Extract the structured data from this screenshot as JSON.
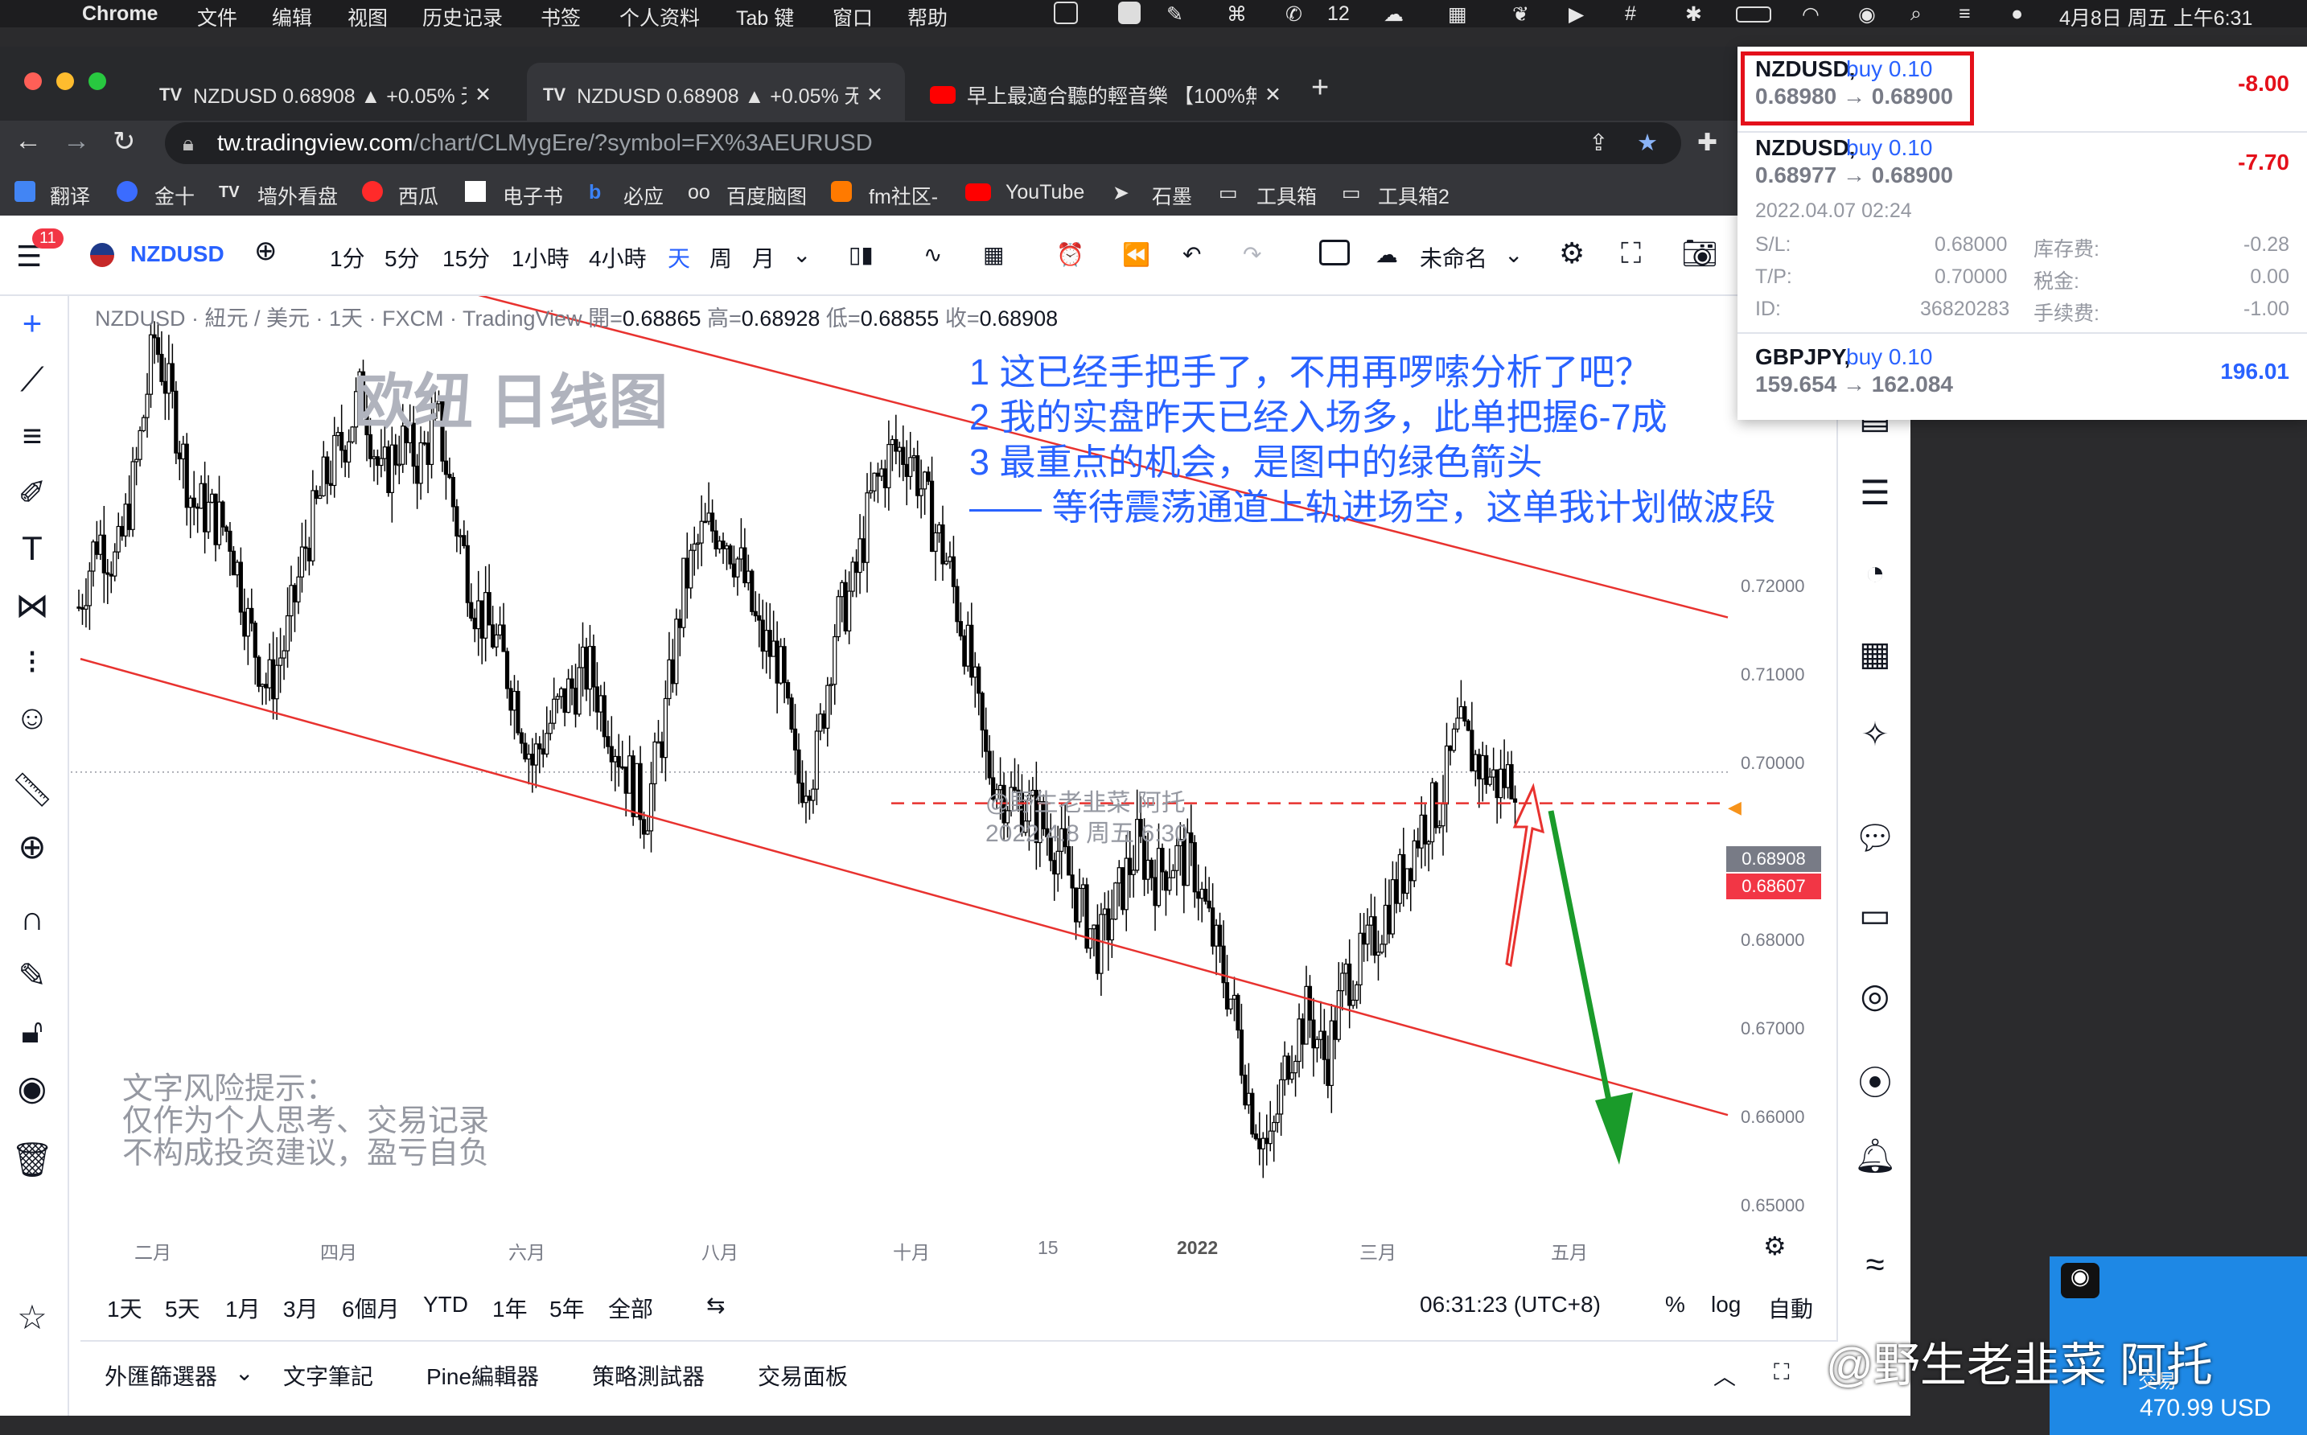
{
  "menubar": {
    "app": "Chrome",
    "items": [
      "文件",
      "编辑",
      "视图",
      "历史记录",
      "书签",
      "个人资料",
      "Tab 键",
      "窗口",
      "帮助"
    ],
    "wechat_count": "12",
    "datetime": "4月8日 周五 上午6:31"
  },
  "tabs": [
    {
      "title": "NZDUSD 0.68908 ▲ +0.05% 无"
    },
    {
      "title": "NZDUSD 0.68908 ▲ +0.05% 无"
    },
    {
      "title": "早上最適合聽的輕音樂 【100%無"
    }
  ],
  "address": {
    "url_host": "tw.tradingview.com",
    "url_path": "/chart/CLMygEre/?symbol=FX%3AEURUSD"
  },
  "bookmarks": [
    "翻译",
    "金十",
    "墙外看盘",
    "西瓜",
    "电子书",
    "必应",
    "百度脑图",
    "fm社区-",
    "YouTube",
    "石墨",
    "工具箱",
    "工具箱2"
  ],
  "toolbar": {
    "badge": "11",
    "symbol": "NZDUSD",
    "intervals": [
      "1分",
      "5分",
      "15分",
      "1小時",
      "4小時",
      "天",
      "周",
      "月"
    ],
    "active_interval": "天",
    "layout_name": "未命名"
  },
  "legend": {
    "title": "NZDUSD · 紐元 / 美元 · 1天 · FXCM · TradingView",
    "open_label": "開",
    "open": "0.68865",
    "high_label": "高",
    "high": "0.68928",
    "low_label": "低",
    "low": "0.68855",
    "close_label": "收",
    "close": "0.68908"
  },
  "watermark_title": "欧纽 日线图",
  "annotations": [
    "1 这已经手把手了，不用再啰嗦分析了吧？",
    "2 我的实盘昨天已经入场多，此单把握6-7成",
    "3 最重点的机会，是图中的绿色箭头",
    "—— 等待震荡通道上轨进场空，这单我计划做波段"
  ],
  "author_mark": {
    "line1": "@野生老韭菜 阿托",
    "line2": "2022.4.8 周五 6:30"
  },
  "risk_note": [
    "文字风险提示：",
    "仅作为个人思考、交易记录",
    "不构成投资建议，盈亏自负"
  ],
  "price_axis": [
    "0.72000",
    "0.71000",
    "0.70000",
    "0.68000",
    "0.67000",
    "0.66000",
    "0.65000"
  ],
  "price_tags": {
    "current": "0.68908",
    "order": "0.68607"
  },
  "time_axis": [
    "二月",
    "四月",
    "六月",
    "八月",
    "十月",
    "15",
    "2022",
    "三月",
    "五月"
  ],
  "bottom_bar": {
    "ranges": [
      "1天",
      "5天",
      "1月",
      "3月",
      "6個月",
      "YTD",
      "1年",
      "5年",
      "全部"
    ],
    "clock": "06:31:23 (UTC+8)",
    "percent": "%",
    "log": "log",
    "auto": "自動"
  },
  "panels": [
    "外匯篩選器",
    "文字筆記",
    "Pine編輯器",
    "策略測試器",
    "交易面板"
  ],
  "positions": [
    {
      "symbol": "NZDUSD,",
      "side": "buy 0.10",
      "prices": "0.68980 → 0.68900",
      "pnl": "-8.00"
    },
    {
      "symbol": "NZDUSD,",
      "side": "buy 0.10",
      "prices": "0.68977 → 0.68900",
      "pnl": "-7.70",
      "time": "2022.04.07 02:24",
      "sl_label": "S/L:",
      "sl": "0.68000",
      "swap_label": "库存费:",
      "swap": "-0.28",
      "tp_label": "T/P:",
      "tp": "0.70000",
      "tax_label": "税金:",
      "tax": "0.00",
      "id_label": "ID:",
      "id": "36820283",
      "fee_label": "手续费:",
      "fee": "-1.00"
    },
    {
      "symbol": "GBPJPY,",
      "side": "buy 0.10",
      "prices": "159.654 → 162.084",
      "pnl": "196.01"
    }
  ],
  "widget": {
    "balance": "470.99 USD",
    "label": "交易"
  },
  "weibo_mark": "@野生老韭菜 阿托",
  "colors": {
    "channel": "#e8322f",
    "arrow_up": "#e8322f",
    "arrow_down": "#1a9b2a",
    "annotation": "#2962ff",
    "price_tag": "#f23645",
    "current_tag": "#787b86"
  },
  "chart_data": {
    "type": "candlestick",
    "symbol": "NZDUSD",
    "interval": "1D",
    "ylim": [
      0.645,
      0.735
    ],
    "close_path": [
      0.705,
      0.712,
      0.709,
      0.718,
      0.731,
      0.724,
      0.715,
      0.714,
      0.712,
      0.703,
      0.697,
      0.702,
      0.711,
      0.717,
      0.721,
      0.726,
      0.717,
      0.721,
      0.719,
      0.723,
      0.713,
      0.705,
      0.702,
      0.697,
      0.69,
      0.694,
      0.697,
      0.699,
      0.694,
      0.689,
      0.685,
      0.694,
      0.707,
      0.712,
      0.713,
      0.709,
      0.702,
      0.7,
      0.688,
      0.69,
      0.703,
      0.707,
      0.716,
      0.72,
      0.72,
      0.714,
      0.709,
      0.701,
      0.69,
      0.687,
      0.686,
      0.684,
      0.681,
      0.676,
      0.672,
      0.677,
      0.682,
      0.679,
      0.681,
      0.68,
      0.673,
      0.667,
      0.657,
      0.652,
      0.662,
      0.666,
      0.661,
      0.669,
      0.671,
      0.675,
      0.679,
      0.684,
      0.686,
      0.693,
      0.69,
      0.688,
      0.689
    ],
    "channel": {
      "upper": [
        0.745,
        0.704
      ],
      "lower": [
        0.7,
        0.656
      ]
    },
    "order_line": 0.68607,
    "current_price": 0.68908
  }
}
